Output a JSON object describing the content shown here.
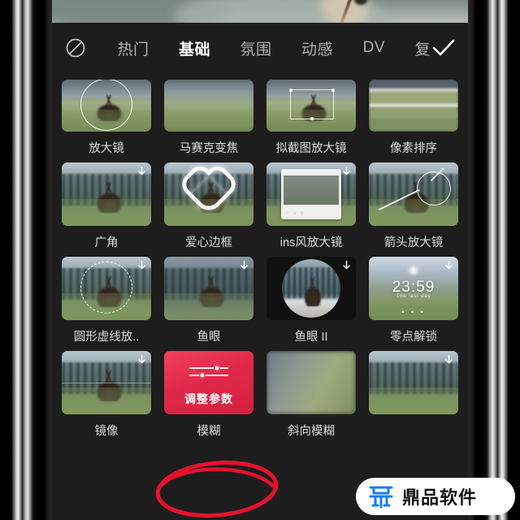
{
  "app": {
    "name": "video-effects-picker",
    "preview_label": "video preview"
  },
  "tabbar": {
    "none_icon": "no-effect-icon",
    "confirm_icon": "check-icon",
    "tabs": [
      {
        "label": "热门",
        "active": false
      },
      {
        "label": "基础",
        "active": true
      },
      {
        "label": "氛围",
        "active": false
      },
      {
        "label": "动感",
        "active": false
      },
      {
        "label": "DV",
        "active": false
      },
      {
        "label": "复",
        "active": false
      }
    ]
  },
  "grid": {
    "rows": [
      {
        "items": [
          {
            "label": "放大镜",
            "download": false,
            "style": "magnify-circle"
          },
          {
            "label": "马赛克变焦",
            "download": false,
            "style": "blur-zoom"
          },
          {
            "label": "拟截图放大镜",
            "download": false,
            "style": "crop-box"
          },
          {
            "label": "像素排序",
            "download": false,
            "style": "pixel-sort"
          }
        ]
      },
      {
        "items": [
          {
            "label": "广角",
            "download": true,
            "style": "wide-angle"
          },
          {
            "label": "爱心边框",
            "download": false,
            "style": "heart-frame"
          },
          {
            "label": "ins风放大镜",
            "download": true,
            "style": "ins-frame"
          },
          {
            "label": "箭头放大镜",
            "download": false,
            "style": "arrow-magnifier"
          }
        ]
      },
      {
        "items": [
          {
            "label": "圆形虚线放..",
            "download": true,
            "style": "dashed-circle"
          },
          {
            "label": "鱼眼",
            "download": true,
            "style": "forest"
          },
          {
            "label": "鱼眼 II",
            "download": true,
            "style": "fisheye"
          },
          {
            "label": "零点解锁",
            "download": true,
            "style": "lockscreen"
          }
        ]
      },
      {
        "items": [
          {
            "label": "镜像",
            "download": true,
            "style": "mirror"
          },
          {
            "label": "模糊",
            "download": false,
            "style": "selected-adjust",
            "selected": true
          },
          {
            "label": "斜向模糊",
            "download": false,
            "style": "diagonal-blur"
          },
          {
            "label": "",
            "download": false,
            "style": "plain"
          }
        ]
      }
    ]
  },
  "selected_tile": {
    "adjust_label": "调整参数",
    "accent_color": "#e0294a"
  },
  "lockscreen_tile": {
    "time": "23:59",
    "subtitle": "The last day",
    "dots": "• • •"
  },
  "annotation": {
    "shape": "red-ellipse-highlight",
    "color": "#e8112d",
    "targets": "模糊"
  },
  "watermark": {
    "text": "鼎品软件",
    "logo_icon": "ding-logo-icon",
    "logo_color": "#1a7cf0",
    "background": "#ffffff"
  }
}
